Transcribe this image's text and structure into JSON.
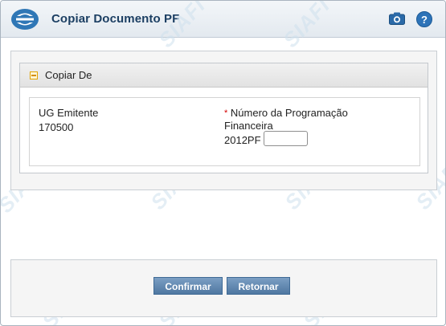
{
  "window": {
    "title": "Copiar Documento PF",
    "watermark": "SIAFI"
  },
  "icons": {
    "logo": "siafi-logo-icon",
    "camera": "camera-icon",
    "help": "help-icon",
    "help_glyph": "?",
    "collapse": "collapse-icon"
  },
  "panel": {
    "title": "Copiar De"
  },
  "fields": {
    "ug_label": "UG Emitente",
    "ug_value": "170500",
    "pf_required_mark": "*",
    "pf_label_line1": "Número da Programação",
    "pf_label_line2": "Financeira",
    "pf_prefix": "2012PF",
    "pf_value": ""
  },
  "buttons": {
    "confirm": "Confirmar",
    "back": "Retornar"
  },
  "colors": {
    "title": "#1c3f63",
    "button": "#5a82ab",
    "help": "#2d73b8"
  }
}
